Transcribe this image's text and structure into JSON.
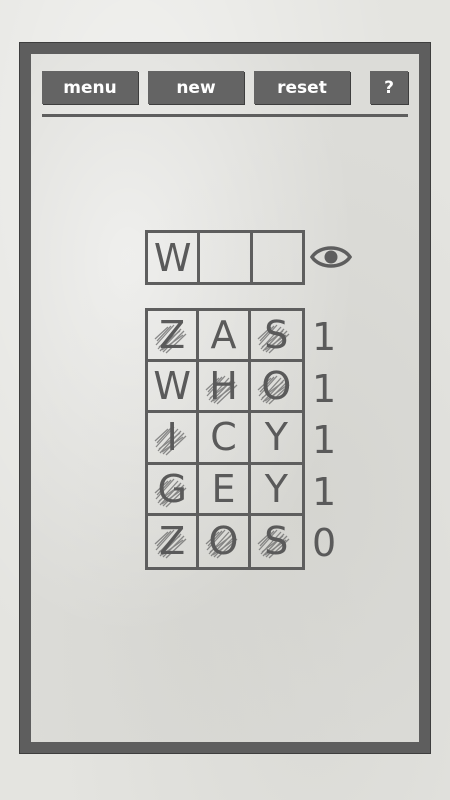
{
  "toolbar": {
    "menu_label": "menu",
    "new_label": "new",
    "reset_label": "reset",
    "help_label": "?"
  },
  "answer": {
    "letters": [
      "W",
      "",
      ""
    ]
  },
  "reveal_icon": "eye-icon",
  "board": {
    "rows": [
      {
        "letters": [
          "Z",
          "A",
          "S"
        ],
        "crossed": [
          true,
          false,
          true
        ],
        "count": "1"
      },
      {
        "letters": [
          "W",
          "H",
          "O"
        ],
        "crossed": [
          false,
          true,
          true
        ],
        "count": "1"
      },
      {
        "letters": [
          "I",
          "C",
          "Y"
        ],
        "crossed": [
          true,
          false,
          false
        ],
        "count": "1"
      },
      {
        "letters": [
          "G",
          "E",
          "Y"
        ],
        "crossed": [
          true,
          false,
          false
        ],
        "count": "1"
      },
      {
        "letters": [
          "Z",
          "O",
          "S"
        ],
        "crossed": [
          true,
          true,
          true
        ],
        "count": "0"
      }
    ]
  },
  "colors": {
    "button_bg": "#646464",
    "button_text": "#ffffff",
    "ink": "#5a5a5a",
    "frame": "#5e5e5e",
    "paper": "#dcdcd8"
  }
}
